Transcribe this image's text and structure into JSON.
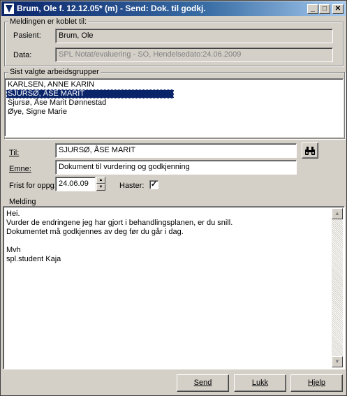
{
  "window": {
    "title": "Brum, Ole f. 12.12.05* (m) - Send: Dok. til godkj.",
    "minimize_glyph": "_",
    "maximize_glyph": "□",
    "close_glyph": "✕"
  },
  "linked": {
    "legend": "Meldingen er koblet til:",
    "patient_label": "Pasient:",
    "patient_value": "Brum, Ole",
    "data_label": "Data:",
    "data_value": "SPL Notat/evaluering - SO, Hendelsedato:24.06.2009"
  },
  "groups": {
    "legend": "Sist valgte arbeidsgrupper",
    "items": [
      "KARLSEN, ANNE KARIN",
      "SJURSØ, ÅSE MARIT",
      "Sjursø, Åse Marit Dønnestad",
      "Øye, Signe Marie"
    ],
    "selected_index": 1
  },
  "form": {
    "to_label": "Til:",
    "to_value": "SJURSØ, ÅSE MARIT",
    "subject_label": "Emne:",
    "subject_value": "Dokument til vurdering og godkjenning",
    "deadline_label": "Frist for oppg:",
    "deadline_value": "24.06.09",
    "urgent_label": "Haster:",
    "urgent_checked": true,
    "check_glyph": "✓",
    "spin_up": "▲",
    "spin_down": "▼",
    "search_icon": "binoculars-icon"
  },
  "message": {
    "label": "Melding",
    "text": "Hei.\nVurder de endringene jeg har gjort i behandlingsplanen, er du snill.\nDokumentet må godkjennes av deg før du går i dag.\n\nMvh\nspl.student Kaja",
    "scroll_up": "▲",
    "scroll_down": "▼"
  },
  "buttons": {
    "send": "Send",
    "close": "Lukk",
    "help": "Hjelp"
  },
  "colors": {
    "title_bar": "#0a246a",
    "selection": "#0a246a",
    "face": "#d4d0c8"
  }
}
